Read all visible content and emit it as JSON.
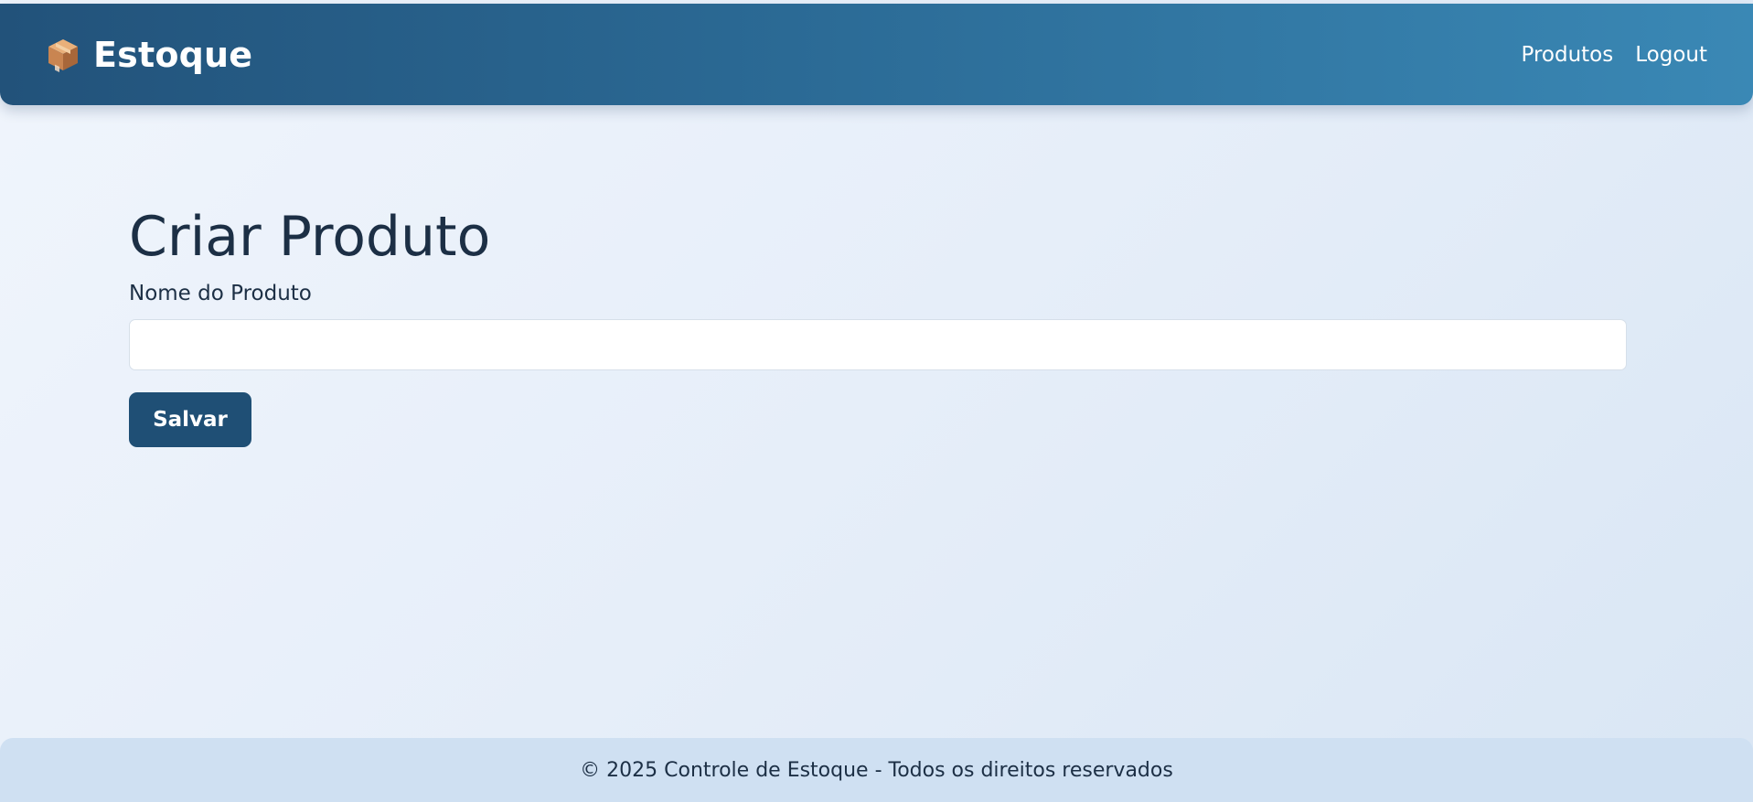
{
  "navbar": {
    "brand_icon": "package-box-icon",
    "brand_text": "Estoque",
    "links": [
      {
        "label": "Produtos"
      },
      {
        "label": "Logout"
      }
    ]
  },
  "main": {
    "title": "Criar Produto",
    "product_name_label": "Nome do Produto",
    "product_name_value": "",
    "product_name_placeholder": "",
    "save_label": "Salvar"
  },
  "footer": {
    "text": "© 2025 Controle de Estoque - Todos os direitos reservados"
  },
  "colors": {
    "navbar_start": "#22527a",
    "navbar_end": "#3a88b5",
    "button_bg": "#1f4f75",
    "text_dark": "#1c2f45",
    "footer_bg": "#cfe0f2"
  }
}
